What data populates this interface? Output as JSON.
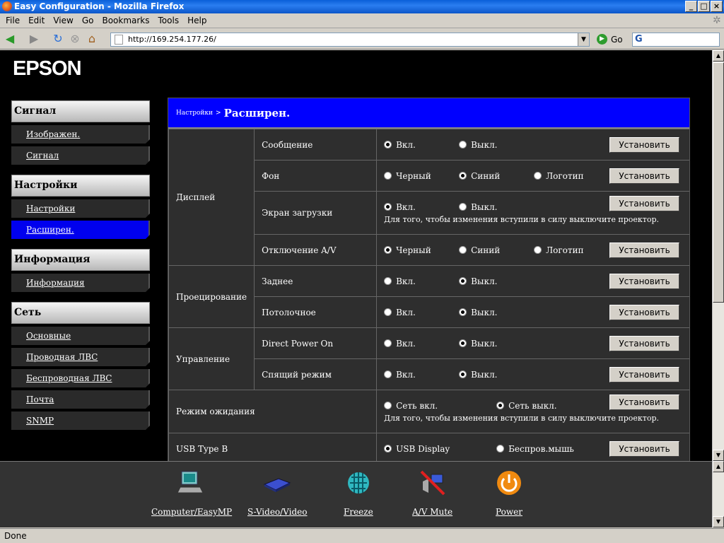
{
  "window": {
    "title": "Easy Configuration - Mozilla Firefox"
  },
  "menu": [
    "File",
    "Edit",
    "View",
    "Go",
    "Bookmarks",
    "Tools",
    "Help"
  ],
  "nav": {
    "url": "http://169.254.177.26/",
    "go_label": "Go",
    "search_logo": "G"
  },
  "status": "Done",
  "logo": "EPSON",
  "sidebar": [
    {
      "title": "Сигнал",
      "items": [
        {
          "label": "Изображен.",
          "active": false
        },
        {
          "label": "Сигнал",
          "active": false
        }
      ]
    },
    {
      "title": "Настройки",
      "items": [
        {
          "label": "Настройки",
          "active": false
        },
        {
          "label": "Расширен.",
          "active": true
        }
      ]
    },
    {
      "title": "Информация",
      "items": [
        {
          "label": "Информация",
          "active": false
        }
      ]
    },
    {
      "title": "Сеть",
      "items": [
        {
          "label": "Основные",
          "active": false
        },
        {
          "label": "Проводная ЛВС",
          "active": false
        },
        {
          "label": "Беспроводная ЛВС",
          "active": false
        },
        {
          "label": "Почта",
          "active": false
        },
        {
          "label": "SNMP",
          "active": false
        }
      ]
    }
  ],
  "breadcrumb": {
    "parent": "Настройки",
    "sep": ">",
    "current": "Расширен."
  },
  "set_label": "Установить",
  "settings": [
    {
      "group": "Дисплей",
      "name": "Сообщение",
      "options": [
        "Вкл.",
        "Выкл."
      ],
      "selected": 0,
      "note": ""
    },
    {
      "group": "Дисплей",
      "name": "Фон",
      "options": [
        "Черный",
        "Синий",
        "Логотип"
      ],
      "selected": 1,
      "note": ""
    },
    {
      "group": "Дисплей",
      "name": "Экран загрузки",
      "options": [
        "Вкл.",
        "Выкл."
      ],
      "selected": 0,
      "note": "Для того, чтобы изменения вступили в силу выключите проектор."
    },
    {
      "group": "Дисплей",
      "name": "Отключение A/V",
      "options": [
        "Черный",
        "Синий",
        "Логотип"
      ],
      "selected": 0,
      "note": ""
    },
    {
      "group": "Проецирование",
      "name": "Заднее",
      "options": [
        "Вкл.",
        "Выкл."
      ],
      "selected": 1,
      "note": ""
    },
    {
      "group": "Проецирование",
      "name": "Потолочное",
      "options": [
        "Вкл.",
        "Выкл."
      ],
      "selected": 1,
      "note": ""
    },
    {
      "group": "Управление",
      "name": "Direct Power On",
      "options": [
        "Вкл.",
        "Выкл."
      ],
      "selected": 1,
      "note": ""
    },
    {
      "group": "Управление",
      "name": "Спящий режим",
      "options": [
        "Вкл.",
        "Выкл."
      ],
      "selected": 1,
      "note": ""
    },
    {
      "group": "Режим ожидания",
      "name": "",
      "options": [
        "Сеть вкл.",
        "Сеть выкл."
      ],
      "selected": 1,
      "note": "Для того, чтобы изменения вступили в силу выключите проектор."
    },
    {
      "group": "USB Type B",
      "name": "",
      "options": [
        "USB Display",
        "Беспров.мышь"
      ],
      "selected": 0,
      "note": ""
    }
  ],
  "footer": [
    {
      "label": "Computer/EasyMP",
      "icon": "computer-icon"
    },
    {
      "label": "S-Video/Video",
      "icon": "video-device-icon"
    },
    {
      "label": "Freeze",
      "icon": "freeze-icon"
    },
    {
      "label": "A/V Mute",
      "icon": "av-mute-icon"
    },
    {
      "label": "Power",
      "icon": "power-icon"
    }
  ]
}
